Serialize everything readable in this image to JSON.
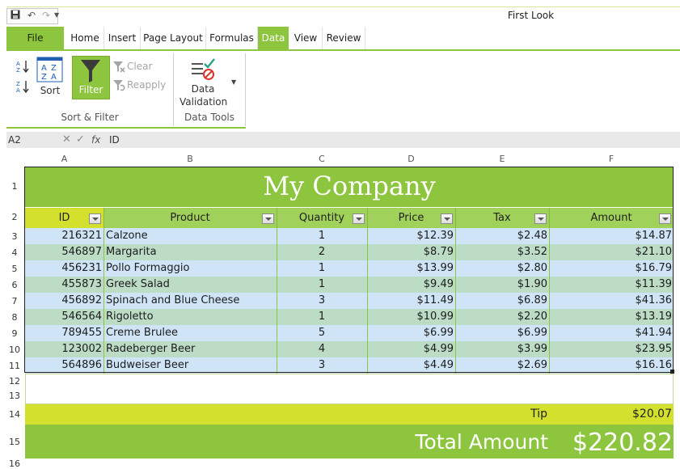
{
  "window": {
    "title": "First Look"
  },
  "qat": {
    "save_icon": "save-icon",
    "undo_icon": "undo-icon",
    "redo_icon": "redo-icon"
  },
  "tabs": [
    {
      "label": "File"
    },
    {
      "label": "Home"
    },
    {
      "label": "Insert"
    },
    {
      "label": "Page Layout"
    },
    {
      "label": "Formulas"
    },
    {
      "label": "Data"
    },
    {
      "label": "View"
    },
    {
      "label": "Review"
    }
  ],
  "ribbon": {
    "sort_label": "Sort",
    "filter_label": "Filter",
    "clear_label": "Clear",
    "reapply_label": "Reapply",
    "data_validation_line1": "Data",
    "data_validation_line2": "Validation",
    "group_sort_filter": "Sort & Filter",
    "group_data_tools": "Data Tools"
  },
  "formula_bar": {
    "name_box": "A2",
    "fx": "fx",
    "value": "ID"
  },
  "columns": [
    "A",
    "B",
    "C",
    "D",
    "E",
    "F"
  ],
  "rows": [
    "1",
    "2",
    "3",
    "4",
    "5",
    "6",
    "7",
    "8",
    "9",
    "10",
    "11",
    "12",
    "13",
    "14",
    "15",
    "16"
  ],
  "sheet": {
    "title": "My Company",
    "headers": [
      "ID",
      "Product",
      "Quantity",
      "Price",
      "Tax",
      "Amount"
    ],
    "data": [
      [
        "216321",
        "Calzone",
        "1",
        "$12.39",
        "$2.48",
        "$14.87"
      ],
      [
        "546897",
        "Margarita",
        "2",
        "$8.79",
        "$3.52",
        "$21.10"
      ],
      [
        "456231",
        "Pollo Formaggio",
        "1",
        "$13.99",
        "$2.80",
        "$16.79"
      ],
      [
        "455873",
        "Greek Salad",
        "1",
        "$9.49",
        "$1.90",
        "$11.39"
      ],
      [
        "456892",
        "Spinach and Blue Cheese",
        "3",
        "$11.49",
        "$6.89",
        "$41.36"
      ],
      [
        "546564",
        "Rigoletto",
        "1",
        "$10.99",
        "$2.20",
        "$13.19"
      ],
      [
        "789455",
        "Creme Brulee",
        "5",
        "$6.99",
        "$6.99",
        "$41.94"
      ],
      [
        "123002",
        "Radeberger Beer",
        "4",
        "$4.99",
        "$3.99",
        "$23.95"
      ],
      [
        "564896",
        "Budweiser Beer",
        "3",
        "$4.49",
        "$2.69",
        "$16.16"
      ]
    ],
    "tip_label": "Tip",
    "tip_value": "$20.07",
    "total_label": "Total Amount",
    "total_value": "$220.82"
  },
  "colors": {
    "accent": "#8dc53e",
    "header_row": "#a0d15a",
    "id_header": "#d3e02e",
    "row_blue": "#cfe5f7",
    "row_green": "#bcdcc6",
    "tip_row": "#d3e02e"
  }
}
